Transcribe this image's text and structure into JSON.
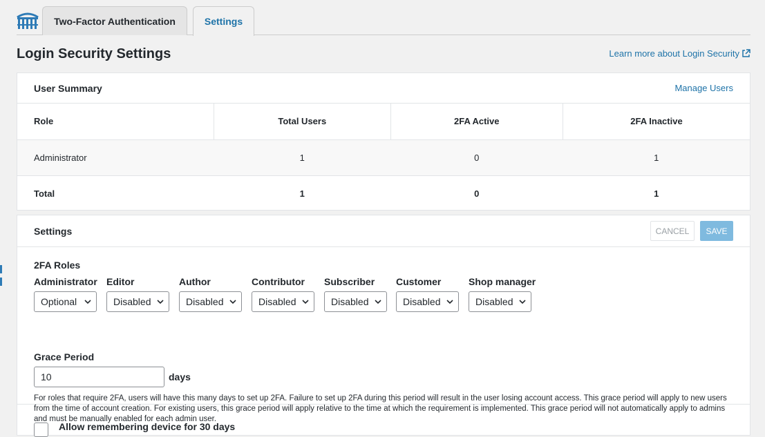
{
  "tabs": [
    {
      "label": "Two-Factor Authentication",
      "active": false
    },
    {
      "label": "Settings",
      "active": true
    }
  ],
  "page": {
    "title": "Login Security Settings",
    "learn_more": "Learn more about Login Security"
  },
  "summary": {
    "title": "User Summary",
    "manage_users": "Manage Users",
    "columns": [
      "Role",
      "Total Users",
      "2FA Active",
      "2FA Inactive"
    ],
    "rows": [
      {
        "role": "Administrator",
        "total": "1",
        "active": "0",
        "inactive": "1"
      }
    ],
    "total": {
      "role": "Total",
      "total": "1",
      "active": "0",
      "inactive": "1"
    }
  },
  "settings": {
    "title": "Settings",
    "cancel_label": "CANCEL",
    "save_label": "SAVE",
    "roles_label": "2FA Roles",
    "roles": [
      {
        "name": "Administrator",
        "value": "Optional"
      },
      {
        "name": "Editor",
        "value": "Disabled"
      },
      {
        "name": "Author",
        "value": "Disabled"
      },
      {
        "name": "Contributor",
        "value": "Disabled"
      },
      {
        "name": "Subscriber",
        "value": "Disabled"
      },
      {
        "name": "Customer",
        "value": "Disabled"
      },
      {
        "name": "Shop manager",
        "value": "Disabled"
      }
    ],
    "grace_label": "Grace Period",
    "grace_value": "10",
    "grace_unit": "days",
    "grace_help": "For roles that require 2FA, users will have this many days to set up 2FA. Failure to set up 2FA during this period will result in the user losing account access. This grace period will apply to new users from the time of account creation. For existing users, this grace period will apply relative to the time at which the requirement is implemented. This grace period will not automatically apply to admins and must be manually enabled for each admin user.",
    "remember_label": "Allow remembering device for 30 days"
  },
  "colors": {
    "link": "#1e73a8",
    "save_button": "#7fbadf",
    "background": "#f1f1f1"
  },
  "icons": [
    "wordfence-logo-icon",
    "external-link-icon",
    "chevron-down-icon"
  ]
}
